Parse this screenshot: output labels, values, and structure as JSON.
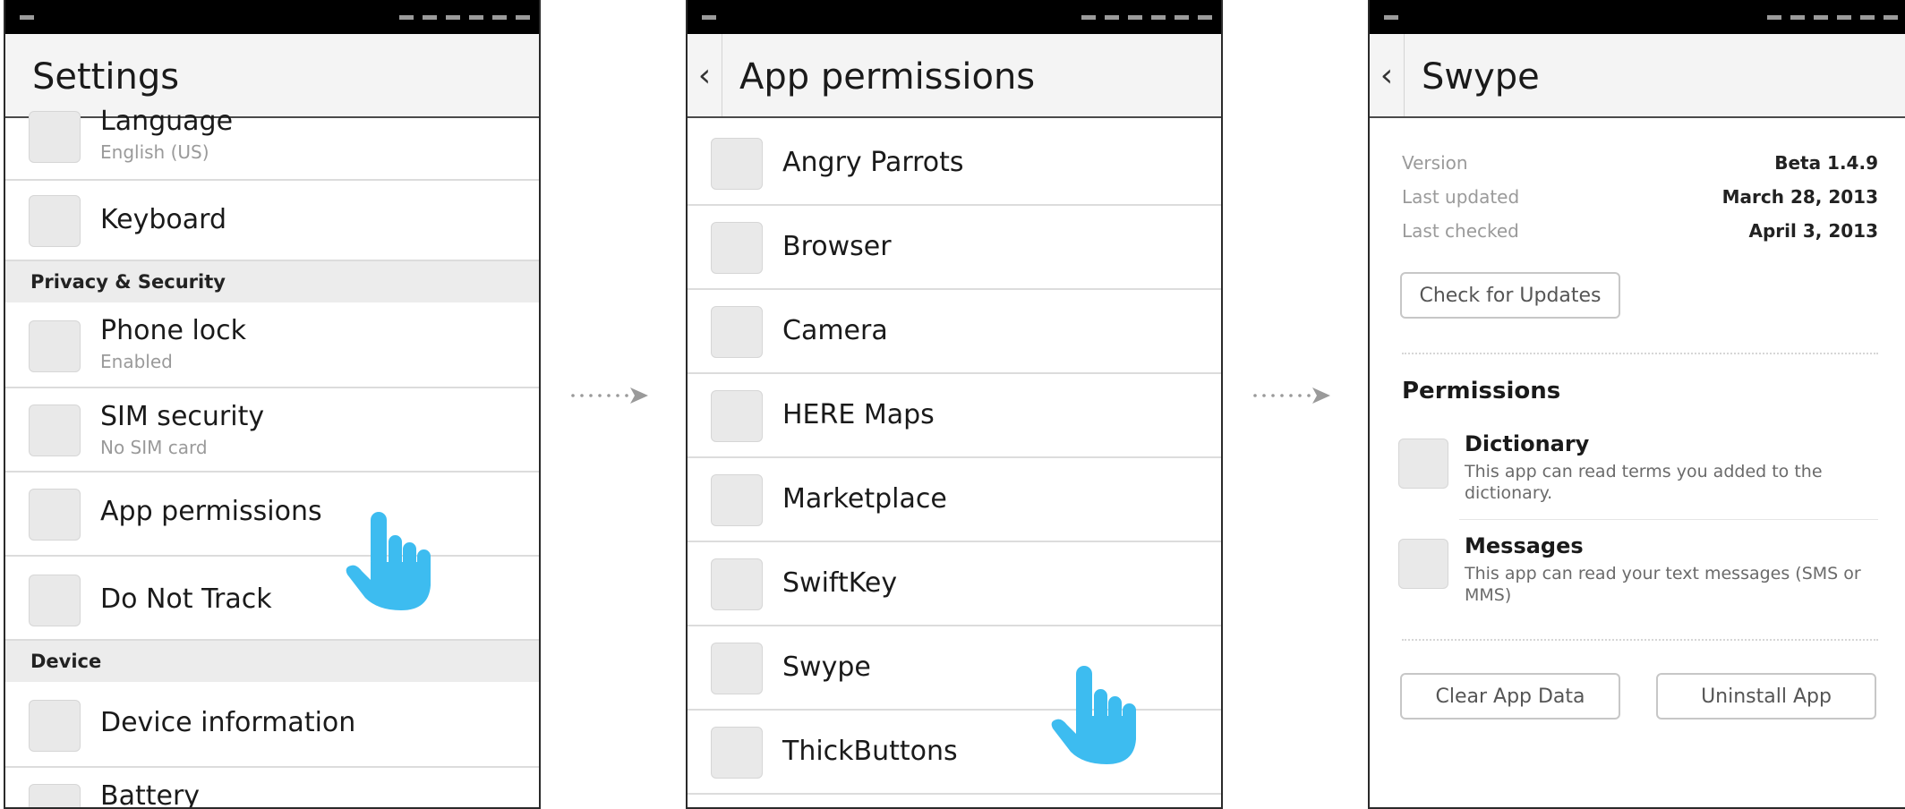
{
  "colors": {
    "accent_hand": "#3dbcf0",
    "status_bar": "#000000",
    "divider": "#dcdcdc"
  },
  "icons": {
    "back": "chevron-left-icon",
    "pointer": "pointing-hand-icon",
    "arrow": "dotted-arrow-icon"
  },
  "settings": {
    "title": "Settings",
    "rows": [
      {
        "label": "Language",
        "sub": "English (US)"
      },
      {
        "label": "Keyboard"
      },
      {
        "section": "Privacy & Security"
      },
      {
        "label": "Phone lock",
        "sub": "Enabled"
      },
      {
        "label": "SIM security",
        "sub": "No SIM card"
      },
      {
        "label": "App permissions"
      },
      {
        "label": "Do Not Track"
      },
      {
        "section": "Device"
      },
      {
        "label": "Device information"
      },
      {
        "label": "Battery"
      }
    ]
  },
  "app_permissions": {
    "title": "App permissions",
    "apps": [
      "Angry Parrots",
      "Browser",
      "Camera",
      "HERE Maps",
      "Marketplace",
      "SwiftKey",
      "Swype",
      "ThickButtons"
    ]
  },
  "app_detail": {
    "title": "Swype",
    "info": [
      {
        "key": "Version",
        "value": "Beta 1.4.9"
      },
      {
        "key": "Last updated",
        "value": "March 28, 2013"
      },
      {
        "key": "Last checked",
        "value": "April 3, 2013"
      }
    ],
    "check_button": "Check for Updates",
    "permissions_title": "Permissions",
    "permissions": [
      {
        "name": "Dictionary",
        "desc": "This app can read terms you added to the dictionary."
      },
      {
        "name": "Messages",
        "desc": "This app can read your text messages (SMS or MMS)"
      }
    ],
    "clear_button": "Clear App Data",
    "uninstall_button": "Uninstall App"
  }
}
